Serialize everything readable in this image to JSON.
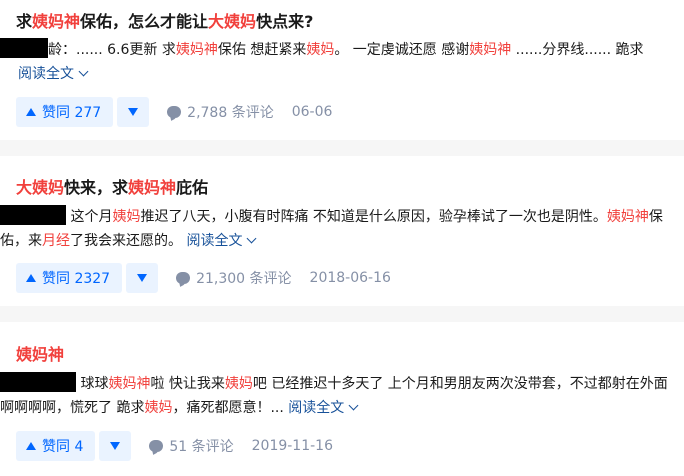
{
  "colors": {
    "highlight": "#f1403c",
    "link": "#175199",
    "vote": "#0066ff",
    "meta": "#8590a6"
  },
  "cards": [
    {
      "title": [
        "求",
        "姨妈神",
        "保佑，怎么才能让",
        "大姨妈",
        "快点来?"
      ],
      "excerpt": [
        "龄：...... 6.6更新 求",
        "姨妈神",
        "保佑 想赶紧来",
        "姨妈",
        "。 一定虔诚还愿 感谢",
        "姨妈神",
        " ......分界线...... 跪求"
      ],
      "read_more": "阅读全文",
      "vote": "赞同 277",
      "comments": "2,788 条评论",
      "date": "06-06"
    },
    {
      "title": [
        "大姨妈",
        "快来，求",
        "姨妈神",
        "庇佑"
      ],
      "excerpt": [
        " 这个月",
        "姨妈",
        "推迟了八天，小腹有时阵痛 不知道是什么原因，验孕棒试了一次也是阴性。",
        "姨妈神",
        "保佑，来",
        "月经",
        "了我会来还愿的。"
      ],
      "read_more": "阅读全文",
      "vote": "赞同 2327",
      "comments": "21,300 条评论",
      "date": "2018-06-16"
    },
    {
      "title": [
        "姨妈神"
      ],
      "excerpt": [
        " 球球",
        "姨妈神",
        "啦 快让我来",
        "姨妈",
        "吧 已经推迟十多天了 上个月和男朋友两次没带套，不过都射在外面 啊啊啊啊，慌死了 跪求",
        "姨妈",
        "，痛死都愿意！..."
      ],
      "read_more": "阅读全文",
      "vote": "赞同 4",
      "comments": "51 条评论",
      "date": "2019-11-16"
    }
  ]
}
